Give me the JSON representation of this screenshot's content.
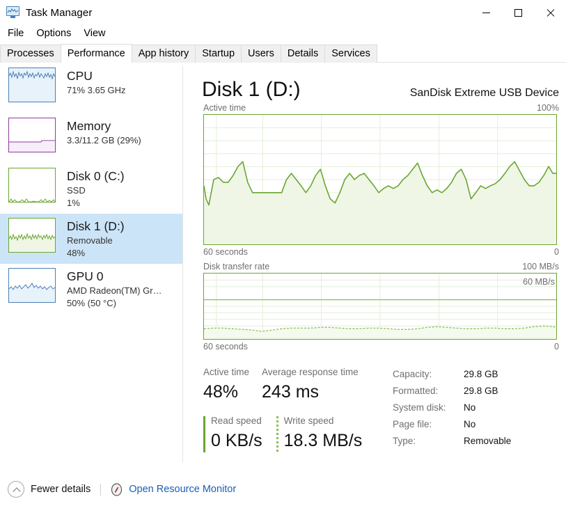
{
  "window": {
    "title": "Task Manager",
    "icon": "task-manager-icon",
    "controls": {
      "minimize": "minimize-icon",
      "maximize": "maximize-icon",
      "close": "close-icon"
    }
  },
  "menu": {
    "items": [
      "File",
      "Options",
      "View"
    ]
  },
  "tabs": {
    "items": [
      "Processes",
      "Performance",
      "App history",
      "Startup",
      "Users",
      "Details",
      "Services"
    ],
    "active": "Performance"
  },
  "sidebar": {
    "items": [
      {
        "title": "CPU",
        "sub1": "71%  3.65 GHz",
        "sub2": "",
        "selected": false,
        "color": "#4a7fb5",
        "fill": "#e8f2fb"
      },
      {
        "title": "Memory",
        "sub1": "3.3/11.2 GB (29%)",
        "sub2": "",
        "selected": false,
        "color": "#8e3a9c",
        "fill": "#f6eef8"
      },
      {
        "title": "Disk 0 (C:)",
        "sub1": "SSD",
        "sub2": "1%",
        "selected": false,
        "color": "#6aa531",
        "fill": "#eff6e6"
      },
      {
        "title": "Disk 1 (D:)",
        "sub1": "Removable",
        "sub2": "48%",
        "selected": true,
        "color": "#6aa531",
        "fill": "#eff6e6"
      },
      {
        "title": "GPU 0",
        "sub1": "AMD Radeon(TM) Gr…",
        "sub2": "50%  (50 °C)",
        "selected": false,
        "color": "#4a7fb5",
        "fill": "#e8f2fb"
      }
    ]
  },
  "main": {
    "title": "Disk 1 (D:)",
    "device": "SanDisk Extreme USB Device",
    "graph_top": {
      "label": "Active time",
      "max_label": "100%",
      "x_left_label": "60 seconds",
      "x_right_label": "0"
    },
    "graph_bottom": {
      "label": "Disk transfer rate",
      "max_label": "100 MB/s",
      "scale_tag": "60 MB/s",
      "x_left_label": "60 seconds",
      "x_right_label": "0"
    },
    "stats": {
      "active_time_label": "Active time",
      "active_time_value": "48%",
      "avg_response_label": "Average response time",
      "avg_response_value": "243 ms",
      "read_label": "Read speed",
      "read_value": "0 KB/s",
      "write_label": "Write speed",
      "write_value": "18.3 MB/s",
      "details": [
        {
          "key": "Capacity:",
          "value": "29.8 GB"
        },
        {
          "key": "Formatted:",
          "value": "29.8 GB"
        },
        {
          "key": "System disk:",
          "value": "No"
        },
        {
          "key": "Page file:",
          "value": "No"
        },
        {
          "key": "Type:",
          "value": "Removable"
        }
      ]
    }
  },
  "footer": {
    "fewer_details": "Fewer details",
    "resource_monitor": "Open Resource Monitor"
  },
  "colors": {
    "disk_green": "#6aa531",
    "disk_green_fill": "#eff6e6",
    "cpu_blue": "#4a7fb5",
    "memory_purple": "#8e3a9c",
    "selection_blue": "#cce4f7",
    "link_blue": "#1a5fb4"
  },
  "chart_data": [
    {
      "type": "area",
      "name": "active-time-graph",
      "title": "Active time",
      "ylabel": "",
      "xlabel": "",
      "ylim": [
        0,
        100
      ],
      "xlim": [
        60,
        0
      ],
      "x_left_label": "60 seconds",
      "x_right_label": "0",
      "grid": true,
      "grid_cols": 6,
      "grid_rows": 10,
      "line_color": "#6aa531",
      "fill_color": "#eff6e6",
      "values": [
        45,
        30,
        15,
        48,
        50,
        42,
        42,
        52,
        60,
        64,
        48,
        40,
        40,
        40,
        40,
        40,
        40,
        48,
        56,
        50,
        44,
        40,
        44,
        52,
        60,
        42,
        36,
        34,
        40,
        48,
        52,
        46,
        50,
        54,
        48,
        42,
        40,
        44,
        42,
        44,
        42,
        46,
        54,
        60,
        48,
        41,
        40,
        43,
        42,
        46,
        50,
        56,
        60,
        48,
        38,
        40,
        44,
        42,
        43,
        46,
        52,
        58,
        62,
        54,
        46,
        42,
        42,
        44,
        50,
        56,
        60,
        54
      ]
    },
    {
      "type": "area",
      "name": "disk-transfer-rate-graph",
      "title": "Disk transfer rate",
      "ylabel": "",
      "xlabel": "",
      "ylim": [
        0,
        100
      ],
      "unit": "MB/s",
      "scale_tag": "60 MB/s",
      "x_left_label": "60 seconds",
      "x_right_label": "0",
      "grid": true,
      "grid_cols": 6,
      "grid_rows": 10,
      "line_color": "#8cbf4f",
      "fill_color": "#f5faef",
      "values": [
        15,
        16,
        16,
        15,
        14,
        13,
        11,
        13,
        15,
        16,
        16,
        16,
        17,
        17,
        16,
        15,
        15,
        16,
        16,
        15,
        14,
        14,
        15,
        17,
        18,
        17,
        16,
        15,
        15,
        16,
        16,
        15,
        15,
        16,
        18,
        19,
        18,
        17,
        16,
        15,
        15,
        15,
        16,
        16,
        15,
        14,
        14,
        15,
        16,
        17,
        17,
        16,
        15,
        15,
        16,
        17,
        19,
        19,
        18,
        17,
        16,
        16,
        16,
        16,
        17,
        17,
        16,
        16,
        15,
        15,
        16,
        16
      ]
    }
  ]
}
